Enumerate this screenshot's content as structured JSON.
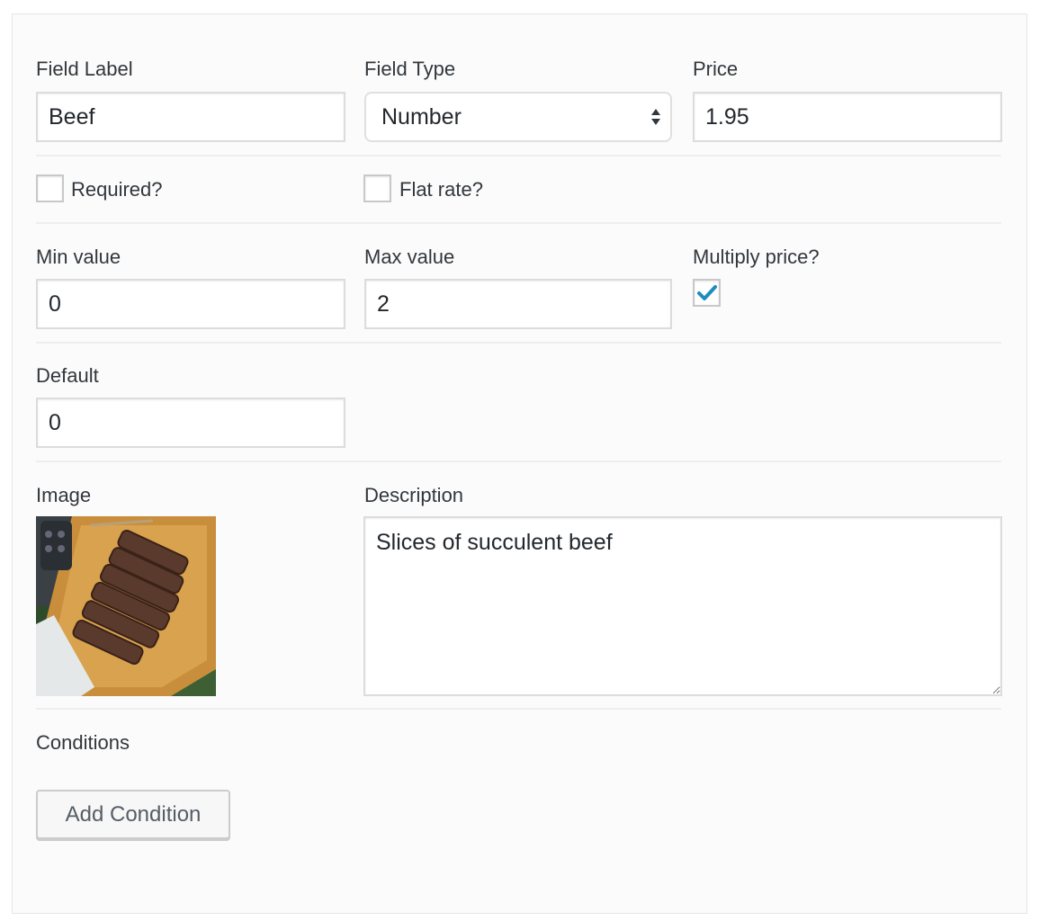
{
  "form": {
    "field_label": {
      "label": "Field Label",
      "value": "Beef"
    },
    "field_type": {
      "label": "Field Type",
      "selected": "Number"
    },
    "price": {
      "label": "Price",
      "value": "1.95"
    },
    "required": {
      "label": "Required?",
      "checked": false
    },
    "flat_rate": {
      "label": "Flat rate?",
      "checked": false
    },
    "min_value": {
      "label": "Min value",
      "value": "0"
    },
    "max_value": {
      "label": "Max value",
      "value": "2"
    },
    "multiply_price": {
      "label": "Multiply price?",
      "checked": true
    },
    "default": {
      "label": "Default",
      "value": "0"
    },
    "image": {
      "label": "Image",
      "alt": "Slices of steak on a wooden cutting board"
    },
    "description": {
      "label": "Description",
      "value": "Slices of succulent beef"
    },
    "conditions": {
      "label": "Conditions",
      "add_button": "Add Condition"
    }
  },
  "colors": {
    "checkmark": "#1e8cbe",
    "panel_bg": "#fbfbfb",
    "border": "#dcdcdc"
  }
}
